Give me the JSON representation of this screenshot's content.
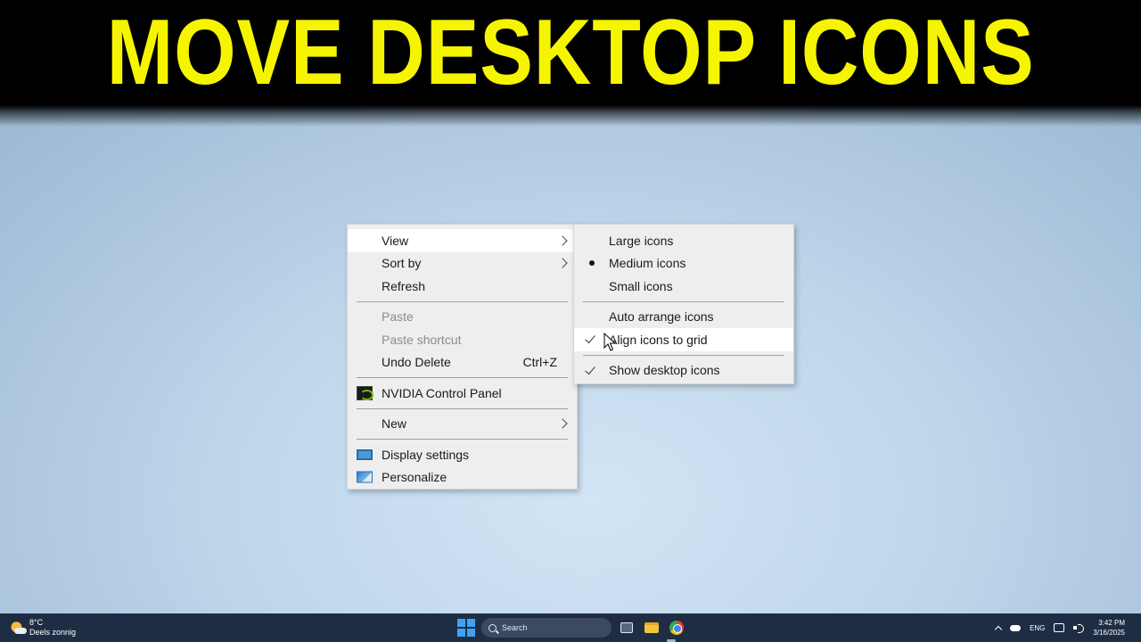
{
  "banner": {
    "title": "MOVE DESKTOP ICONS",
    "title_color": "#f6f500",
    "background": "#000000"
  },
  "context_menu": {
    "items": [
      {
        "label": "View",
        "submenu": true,
        "highlighted": true
      },
      {
        "label": "Sort by",
        "submenu": true
      },
      {
        "label": "Refresh"
      },
      {
        "label": "Paste",
        "disabled": true
      },
      {
        "label": "Paste shortcut",
        "disabled": true
      },
      {
        "label": "Undo Delete",
        "shortcut": "Ctrl+Z"
      },
      {
        "label": "NVIDIA Control Panel",
        "icon": "nvidia-icon"
      },
      {
        "label": "New",
        "submenu": true
      },
      {
        "label": "Display settings",
        "icon": "display-settings-icon"
      },
      {
        "label": "Personalize",
        "icon": "personalize-icon"
      }
    ]
  },
  "view_submenu": {
    "items": [
      {
        "label": "Large icons"
      },
      {
        "label": "Medium icons",
        "selected": true
      },
      {
        "label": "Small icons"
      },
      {
        "label": "Auto arrange icons"
      },
      {
        "label": "Align icons to grid",
        "checked": true,
        "highlighted": true
      },
      {
        "label": "Show desktop icons",
        "checked": true
      }
    ]
  },
  "taskbar": {
    "weather": {
      "temperature": "8°C",
      "condition": "Deels zonnig",
      "icon": "partly-sunny-icon"
    },
    "search": {
      "placeholder": "Search"
    },
    "apps": [
      "start-icon",
      "task-view-icon",
      "file-explorer-icon",
      "chrome-icon"
    ],
    "tray": {
      "language": "ENG",
      "time": "3:42 PM",
      "date": "3/16/2025"
    }
  }
}
